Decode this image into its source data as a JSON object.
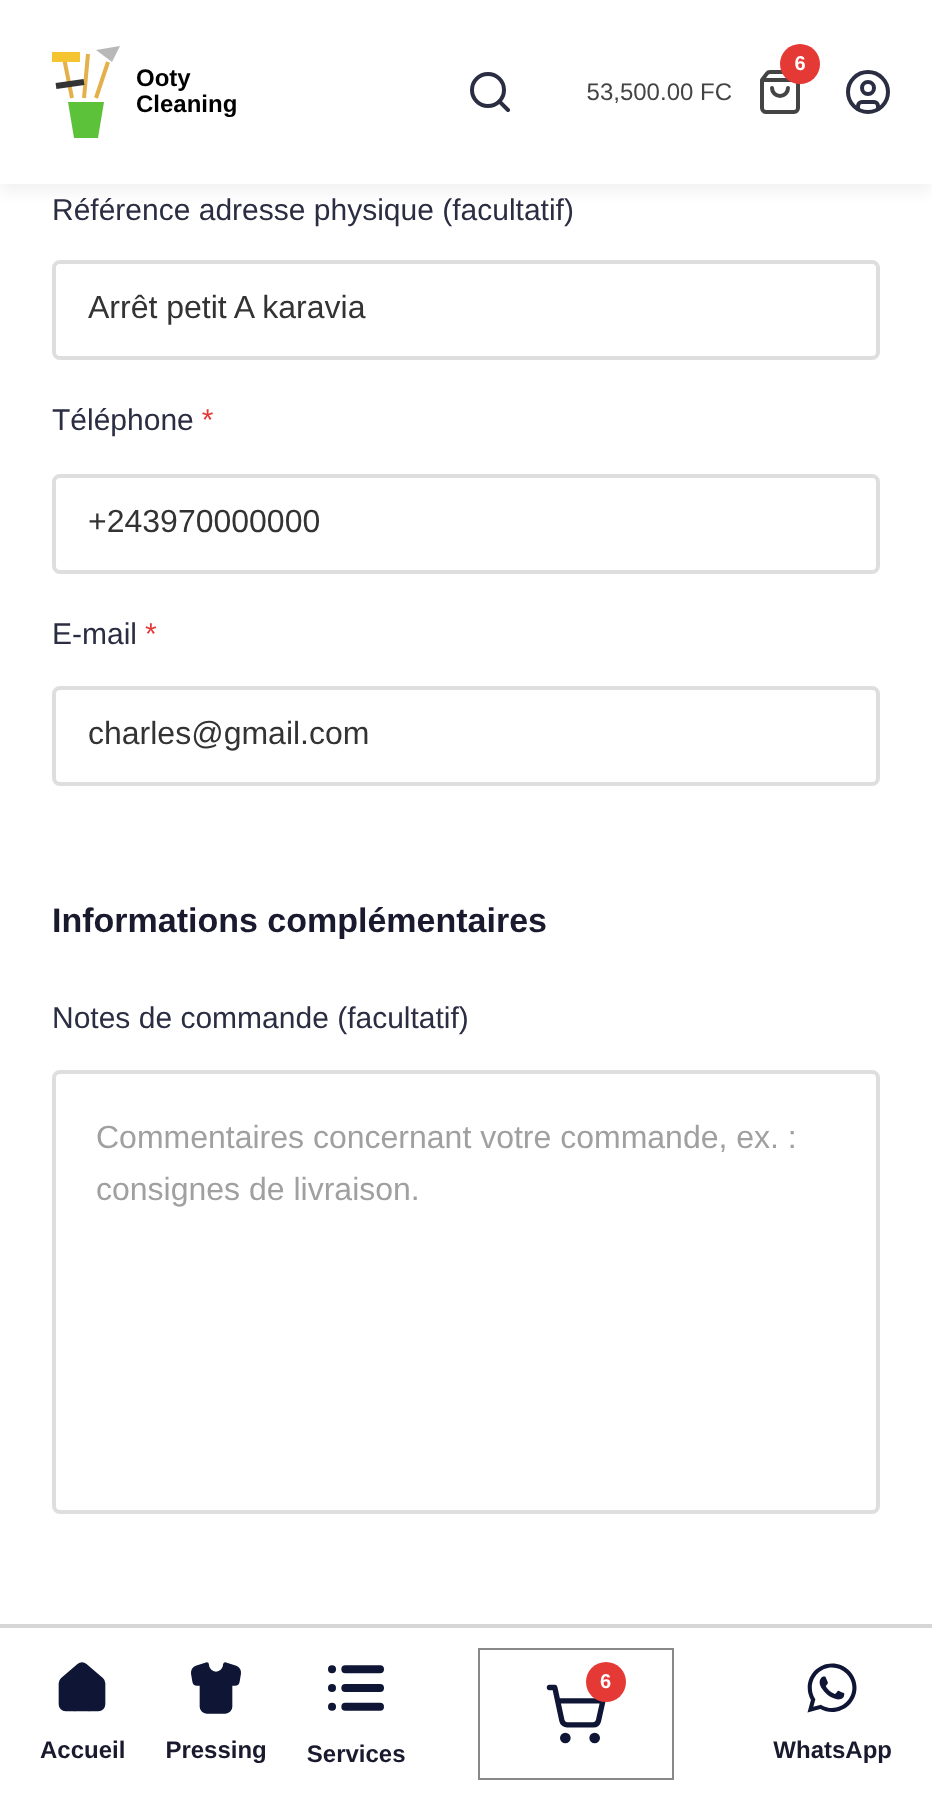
{
  "header": {
    "logo_text": [
      "Ooty",
      "Cleaning"
    ],
    "cart_total": "53,500.00 FC",
    "cart_count": "6"
  },
  "fields": [
    {
      "label": "Référence adresse physique  (facultatif)",
      "value": "Arrêt petit A karavia"
    },
    {
      "label": "Téléphone",
      "required_mark": "*",
      "value": "+243970000000"
    },
    {
      "label": "E-mail",
      "required_mark": "*",
      "value": "charles@gmail.com"
    }
  ],
  "section_title": "Informations complémentaires",
  "notes": {
    "label": "Notes de commande (facultatif)",
    "placeholder": "Commentaires concernant votre commande, ex. : consignes de livraison."
  },
  "bottom_nav": [
    {
      "kind": "home",
      "label": "Accueil"
    },
    {
      "kind": "shirt",
      "label": "Pressing"
    },
    {
      "kind": "list",
      "label": "Services"
    },
    {
      "kind": "cart",
      "badge": "6"
    },
    {
      "kind": "whatsapp",
      "label": "WhatsApp"
    }
  ]
}
